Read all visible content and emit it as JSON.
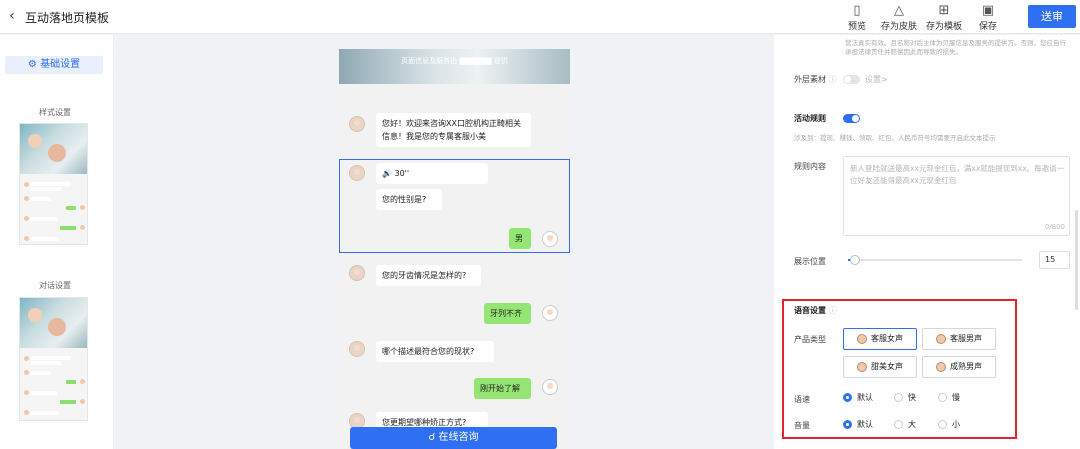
{
  "header": {
    "back_icon": "chevron-left-icon",
    "title": "互动落地页模板",
    "tools": [
      {
        "label": "预览",
        "icon": "phone-icon"
      },
      {
        "label": "存为皮肤",
        "icon": "shirt-icon"
      },
      {
        "label": "存为模板",
        "icon": "layout-icon"
      },
      {
        "label": "保存",
        "icon": "save-icon"
      }
    ],
    "submit_label": "送审"
  },
  "left": {
    "basic_settings": "基础设置",
    "style_settings": "样式设置",
    "dialog_settings": "对话设置"
  },
  "chat": {
    "banner": "页面信息及服务由 ▇▇▇▇▇▇ 提供",
    "greeting": "您好！欢迎来咨询XX口腔机构正畸相关信息！我是您的专属客服小美",
    "voice": "🔊 30''",
    "q_gender": "您的性别是?",
    "a_gender": "男",
    "q_teeth": "您的牙齿情况是怎样的?",
    "a_teeth": "牙列不齐",
    "q_status": "哪个描述最符合您的现状?",
    "a_status": "刚开始了解",
    "q_method": "您更期望哪种矫正方式?",
    "consult_button": "在线咨询"
  },
  "right": {
    "top_hint": "营法真实有效。且名称对后主体为贝服信息及服务的提供方。否则，您应自行承担法律责任并赔偿因此而导致的损失。",
    "outer_material_label": "外层素材",
    "outer_material_setting": "设置>",
    "activity_rule_label": "活动规则",
    "activity_rule_hint": "涉及到：提现、赚钱、领取、红包、人民币符号均需要开启此文本提示",
    "rule_content_label": "规则内容",
    "rule_content_placeholder": "新人登陆就送最高xx元现金红包，满xx就能提现到xx。每邀请一位好友还能得最高xx元现金红包",
    "rule_content_count": "0/800",
    "display_position_label": "展示位置",
    "display_position_value": "15",
    "display_position_level": 0.04,
    "voice": {
      "title": "语音设置",
      "product_type_label": "产品类型",
      "types": [
        "客服女声",
        "客服男声",
        "甜美女声",
        "成熟男声"
      ],
      "selected_type": "客服女声",
      "speed_label": "语速",
      "speed_options": [
        "默认",
        "快",
        "慢"
      ],
      "volume_label": "音量",
      "volume_options": [
        "默认",
        "大",
        "小"
      ]
    }
  },
  "colors": {
    "accent": "#2f6ff1",
    "highlight_border": "#e1242e",
    "reply_bubble": "#94e574"
  }
}
